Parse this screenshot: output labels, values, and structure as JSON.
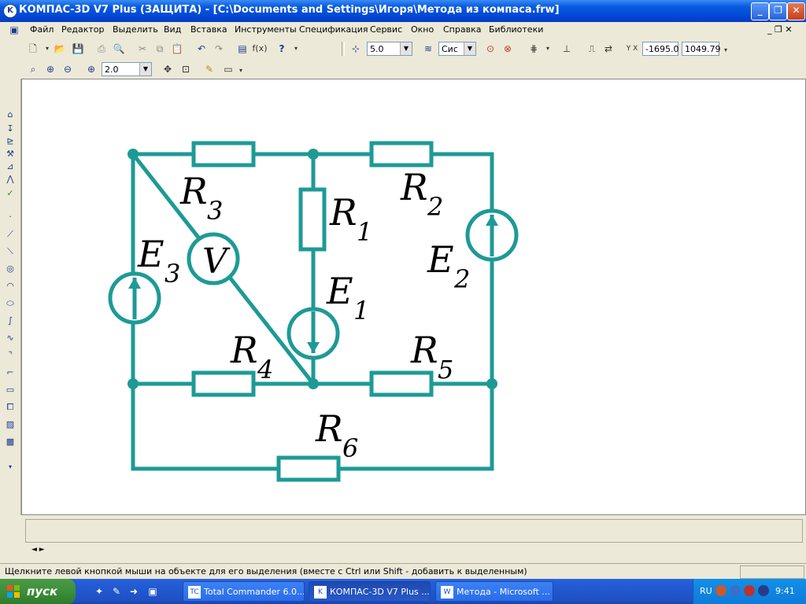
{
  "window": {
    "title": "КОМПАС-3D V7 Plus (ЗАЩИТА) - [C:\\Documents and Settings\\Игоря\\Метода из компаса.frw]",
    "minimize": "_",
    "restore": "❐",
    "close": "✕"
  },
  "menu": {
    "items": [
      "Файл",
      "Редактор",
      "Выделить",
      "Вид",
      "Вставка",
      "Инструменты",
      "Спецификация",
      "Сервис",
      "Окно",
      "Справка",
      "Библиотеки"
    ],
    "doc_controls": "_ ❐ ✕"
  },
  "toolbar1": {
    "fx": "f(x)",
    "step_value": "5.0",
    "style_value": "Сис",
    "coord_x": "-1695.0",
    "coord_y": "1049.79"
  },
  "toolbar2": {
    "zoom_value": "2.0"
  },
  "circuit": {
    "color": "#1e9a96",
    "labels": {
      "R1": "R",
      "R1_sub": "1",
      "R2": "R",
      "R2_sub": "2",
      "R3": "R",
      "R3_sub": "3",
      "R4": "R",
      "R4_sub": "4",
      "R5": "R",
      "R5_sub": "5",
      "R6": "R",
      "R6_sub": "6",
      "E1": "E",
      "E1_sub": "1",
      "E2": "E",
      "E2_sub": "2",
      "E3": "E",
      "E3_sub": "3",
      "V": "V"
    }
  },
  "status": {
    "text": "Щелкните левой кнопкой мыши на объекте для его выделения (вместе с Ctrl или Shift - добавить к выделенным)",
    "scroll": "◄ ►"
  },
  "taskbar": {
    "start": "пуск",
    "tasks": [
      "Total Commander 6.0...",
      "КОМПАС-3D V7 Plus ...",
      "Метода - Microsoft ..."
    ],
    "lang": "RU",
    "clock": "9:41"
  }
}
